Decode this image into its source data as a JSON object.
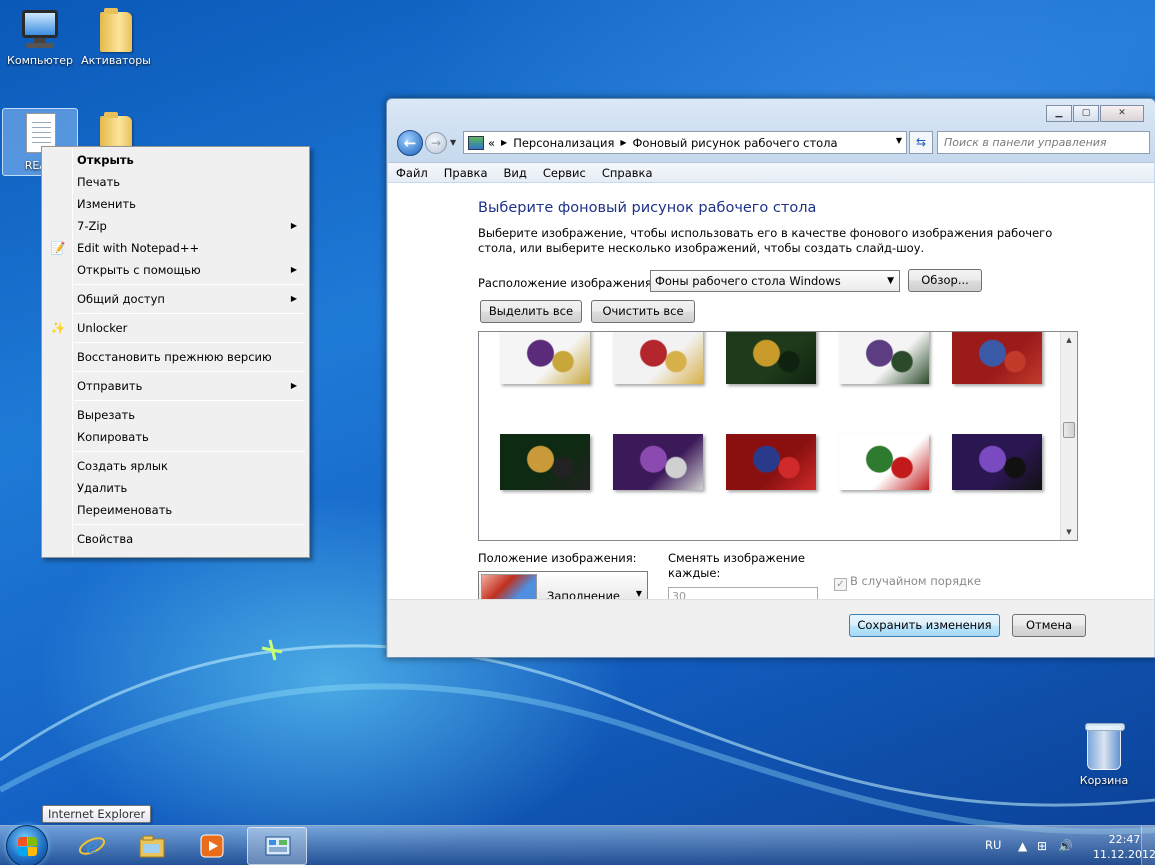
{
  "desktop": {
    "icons": [
      {
        "label": "Компьютер",
        "icon": "computer-icon"
      },
      {
        "label": "Активаторы",
        "icon": "folder-icon"
      },
      {
        "label": "READ",
        "icon": "text-document-icon"
      },
      {
        "label": "",
        "icon": "folder-icon"
      }
    ],
    "recycle_bin": {
      "label": "Корзина",
      "icon": "recycle-bin-icon"
    }
  },
  "context_menu": {
    "groups": [
      [
        {
          "label": "Открыть",
          "bold": true
        },
        {
          "label": "Печать"
        },
        {
          "label": "Изменить"
        },
        {
          "label": "7-Zip",
          "submenu": true
        },
        {
          "label": "Edit with Notepad++",
          "icon": "notepad-plus-icon"
        },
        {
          "label": "Открыть с помощью",
          "submenu": true
        }
      ],
      [
        {
          "label": "Общий доступ",
          "submenu": true
        }
      ],
      [
        {
          "label": "Unlocker",
          "icon": "unlocker-wand-icon"
        }
      ],
      [
        {
          "label": "Восстановить прежнюю версию"
        }
      ],
      [
        {
          "label": "Отправить",
          "submenu": true
        }
      ],
      [
        {
          "label": "Вырезать"
        },
        {
          "label": "Копировать"
        }
      ],
      [
        {
          "label": "Создать ярлык"
        },
        {
          "label": "Удалить"
        },
        {
          "label": "Переименовать"
        }
      ],
      [
        {
          "label": "Свойства"
        }
      ]
    ]
  },
  "window": {
    "breadcrumb": {
      "overflow": "«",
      "items": [
        "Персонализация",
        "Фоновый рисунок рабочего стола"
      ]
    },
    "search_placeholder": "Поиск в панели управления",
    "menu": [
      "Файл",
      "Правка",
      "Вид",
      "Сервис",
      "Справка"
    ],
    "heading": "Выберите фоновый рисунок рабочего стола",
    "description": "Выберите изображение, чтобы использовать его в качестве фонового изображения рабочего стола, или выберите несколько изображений, чтобы создать слайд-шоу.",
    "location_label": "Расположение изображения:",
    "location_value": "Фоны рабочего стола Windows",
    "browse_button": "Обзор...",
    "select_all_button": "Выделить все",
    "clear_all_button": "Очистить все",
    "wallpapers": [
      {
        "colors": [
          "#f5f5f5",
          "#5a2b7a",
          "#c9a63a"
        ]
      },
      {
        "colors": [
          "#f2f2f2",
          "#b3262b",
          "#d8b04a"
        ]
      },
      {
        "colors": [
          "#1e3a1a",
          "#c89a2a",
          "#0f220f"
        ]
      },
      {
        "colors": [
          "#f4f4f4",
          "#5c3d82",
          "#2a4a2a"
        ]
      },
      {
        "colors": [
          "#9b1b1b",
          "#3a5aa8",
          "#c23a2a"
        ]
      },
      {
        "colors": [
          "#0f2a12",
          "#c99a3a",
          "#222222"
        ]
      },
      {
        "colors": [
          "#3c1a5a",
          "#8a4ab0",
          "#d0d0d0"
        ]
      },
      {
        "colors": [
          "#8a1010",
          "#2a3a8a",
          "#d02a2a"
        ]
      },
      {
        "colors": [
          "#ffffff",
          "#2e7a2e",
          "#c21a1a"
        ]
      },
      {
        "colors": [
          "#2a1650",
          "#7a4ac0",
          "#111111"
        ]
      }
    ],
    "position_label": "Положение изображения:",
    "position_value": "Заполнение",
    "change_label": "Сменять изображение каждые:",
    "interval_value": "30",
    "shuffle_label": "В случайном порядке",
    "shuffle_checked": true,
    "save_button": "Сохранить изменения",
    "cancel_button": "Отмена",
    "controls": {
      "minimize": "▁",
      "maximize": "▢",
      "close": "✕"
    }
  },
  "taskbar": {
    "tooltip": "Internet Explorer",
    "buttons": [
      {
        "name": "ie",
        "icon": "internet-explorer-icon"
      },
      {
        "name": "explorer",
        "icon": "windows-explorer-icon"
      },
      {
        "name": "media",
        "icon": "media-player-icon"
      },
      {
        "name": "control-panel",
        "icon": "control-panel-icon",
        "active": true
      }
    ],
    "language": "RU",
    "time": "22:47",
    "date": "11.12.2012"
  }
}
